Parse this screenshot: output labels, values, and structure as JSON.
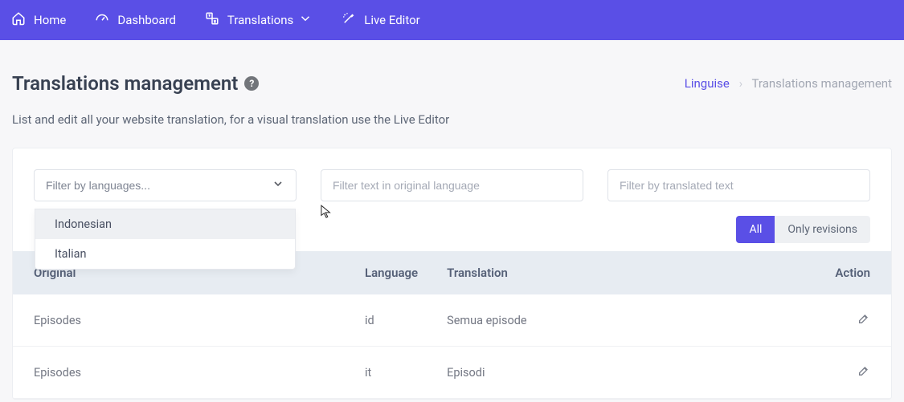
{
  "nav": {
    "home": "Home",
    "dashboard": "Dashboard",
    "translations": "Translations",
    "live_editor": "Live Editor"
  },
  "header": {
    "title": "Translations management",
    "breadcrumb_link": "Linguise",
    "breadcrumb_sep": "›",
    "breadcrumb_current": "Translations management"
  },
  "subtitle": "List and edit all your website translation, for a visual translation use the Live Editor",
  "filters": {
    "lang_placeholder": "Filter by languages...",
    "original_placeholder": "Filter text in original language",
    "translated_placeholder": "Filter by translated text",
    "dropdown": {
      "items": [
        "Indonesian",
        "Italian"
      ]
    }
  },
  "toggle": {
    "all": "All",
    "revisions": "Only revisions"
  },
  "table": {
    "headers": {
      "original": "Original",
      "language": "Language",
      "translation": "Translation",
      "action": "Action"
    },
    "rows": [
      {
        "original": "Episodes",
        "language": "id",
        "translation": "Semua episode"
      },
      {
        "original": "Episodes",
        "language": "it",
        "translation": "Episodi"
      }
    ]
  }
}
